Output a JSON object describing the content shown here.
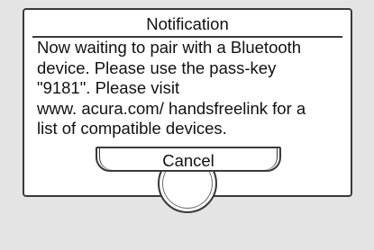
{
  "dialog": {
    "title": "Notification",
    "message": "Now waiting to pair with a Bluetooth\ndevice. Please use the pass-key\n\"9181\". Please visit\nwww. acura.com/ handsfreelink for a\nlist of compatible devices.",
    "cancel_label": "Cancel"
  }
}
